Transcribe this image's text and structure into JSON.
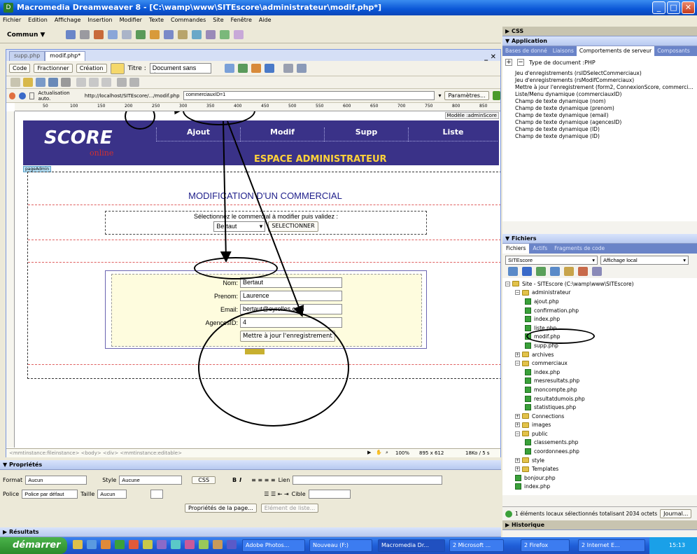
{
  "window": {
    "title": "Macromedia Dreamweaver 8 - [C:\\wamp\\www\\SITEscore\\administrateur\\modif.php*]"
  },
  "menu": [
    "Fichier",
    "Edition",
    "Affichage",
    "Insertion",
    "Modifier",
    "Texte",
    "Commandes",
    "Site",
    "Fenêtre",
    "Aide"
  ],
  "toolbar": {
    "category": "Commun ▼"
  },
  "doc": {
    "tabs": [
      "supp.php",
      "modif.php*"
    ],
    "btn_code": "Code",
    "btn_split": "Fractionner",
    "btn_design": "Création",
    "title_label": "Titre :",
    "title_value": "Document sans titre",
    "live_label": "Actualisation auto.",
    "url": "http://localhost/SITEscore/.../modif.php",
    "params_value": "commerciauxID=1",
    "params_btn": "Paramètres...",
    "template_tag": "Modèle :adminScore",
    "page_admin": "pageAdmin",
    "ruler": [
      "50",
      "100",
      "150",
      "200",
      "250",
      "300",
      "350",
      "400",
      "450",
      "500",
      "550",
      "600",
      "650",
      "700",
      "750",
      "800",
      "850"
    ]
  },
  "page": {
    "logo": "SCORE",
    "logo_sub": "online",
    "nav": [
      "Ajout",
      "Modif",
      "Supp",
      "Liste"
    ],
    "espace": "ESPACE ADMINISTRATEUR",
    "heading": "MODIFICATION D'UN COMMERCIAL",
    "select_prompt": "Sélectionnez le commercial à modifier puis validez :",
    "select_value": "Bertaut",
    "select_btn": "SELECTIONNER",
    "fields": [
      {
        "label": "Nom:",
        "value": "Bertaut"
      },
      {
        "label": "Prenom:",
        "value": "Laurence"
      },
      {
        "label": "Email:",
        "value": "bertaut@eyrolles.com"
      },
      {
        "label": "AgencesID:",
        "value": "4"
      }
    ],
    "submit": "Mettre à jour l'enregistrement"
  },
  "status": {
    "tags": "<mmtinstance:fileinstance> <body> <div> <mmtinstance:editable>",
    "zoom": "100%",
    "size": "895 x 612",
    "weight": "18Ko / 5 s"
  },
  "props": {
    "title": "▼ Propriétés",
    "format_label": "Format",
    "format_value": "Aucun",
    "style_label": "Style",
    "style_value": "Aucune",
    "css_btn": "CSS",
    "link_label": "Lien",
    "font_label": "Police",
    "font_value": "Police par défaut",
    "size_label": "Taille",
    "size_value": "Aucun",
    "target_label": "Cible",
    "page_props_btn": "Propriétés de la page...",
    "list_item_btn": "Elément de liste..."
  },
  "results": "▶ Résultats",
  "right": {
    "css_header": "▶ CSS",
    "app_header": "▼ Application",
    "app_tabs": [
      "Bases de donné",
      "Liaisons",
      "Comportements de serveur",
      "Composants"
    ],
    "doc_type": "Type de document :PHP",
    "behaviors": [
      "Jeu d'enregistrements (rsIDSelectCommerciaux)",
      "Jeu d'enregistrements (rsModifCommerciaux)",
      "Mettre à jour l'enregistrement (form2, ConnexionScore, commerci...",
      "Liste/Menu dynamique (commerciauxID)",
      "Champ de texte dynamique (nom)",
      "Champ de texte dynamique (prenom)",
      "Champ de texte dynamique (email)",
      "Champ de texte dynamique (agencesID)",
      "Champ de texte dynamique (ID)",
      "Champ de texte dynamique (ID)"
    ],
    "files_header": "▼ Fichiers",
    "files_tabs": [
      "Fichiers",
      "Actifs",
      "Fragments de code"
    ],
    "site_select": "SITEscore",
    "view_select": "Affichage local",
    "tree": [
      {
        "t": "Site - SITEscore (C:\\wamp\\www\\SITEscore)",
        "d": 0,
        "k": "site"
      },
      {
        "t": "administrateur",
        "d": 1,
        "k": "folder"
      },
      {
        "t": "ajout.php",
        "d": 2,
        "k": "file"
      },
      {
        "t": "confirmation.php",
        "d": 2,
        "k": "file"
      },
      {
        "t": "index.php",
        "d": 2,
        "k": "file"
      },
      {
        "t": "liste.php",
        "d": 2,
        "k": "file"
      },
      {
        "t": "modif.php",
        "d": 2,
        "k": "file"
      },
      {
        "t": "supp.php",
        "d": 2,
        "k": "file"
      },
      {
        "t": "archives",
        "d": 1,
        "k": "folder"
      },
      {
        "t": "commerciaux",
        "d": 1,
        "k": "folder"
      },
      {
        "t": "index.php",
        "d": 2,
        "k": "file"
      },
      {
        "t": "mesresultats.php",
        "d": 2,
        "k": "file"
      },
      {
        "t": "moncompte.php",
        "d": 2,
        "k": "file"
      },
      {
        "t": "resultatdumois.php",
        "d": 2,
        "k": "file"
      },
      {
        "t": "statistiques.php",
        "d": 2,
        "k": "file"
      },
      {
        "t": "Connections",
        "d": 1,
        "k": "folder"
      },
      {
        "t": "images",
        "d": 1,
        "k": "folder"
      },
      {
        "t": "public",
        "d": 1,
        "k": "folder"
      },
      {
        "t": "classements.php",
        "d": 2,
        "k": "file"
      },
      {
        "t": "coordonnees.php",
        "d": 2,
        "k": "file"
      },
      {
        "t": "style",
        "d": 1,
        "k": "folder"
      },
      {
        "t": "Templates",
        "d": 1,
        "k": "folder"
      },
      {
        "t": "bonjour.php",
        "d": 1,
        "k": "file"
      },
      {
        "t": "index.php",
        "d": 1,
        "k": "file"
      }
    ],
    "files_status": "1 éléments locaux sélectionnés totalisant 2034 octets",
    "journal_btn": "Journal...",
    "history": "▶ Historique"
  },
  "taskbar": {
    "start": "démarrer",
    "tasks": [
      "Adobe Photos...",
      "Nouveau (F:)",
      "Macromedia Dr...",
      "2 Microsoft ...",
      "2 Firefox",
      "2 Internet E..."
    ],
    "clock": "15:13"
  }
}
